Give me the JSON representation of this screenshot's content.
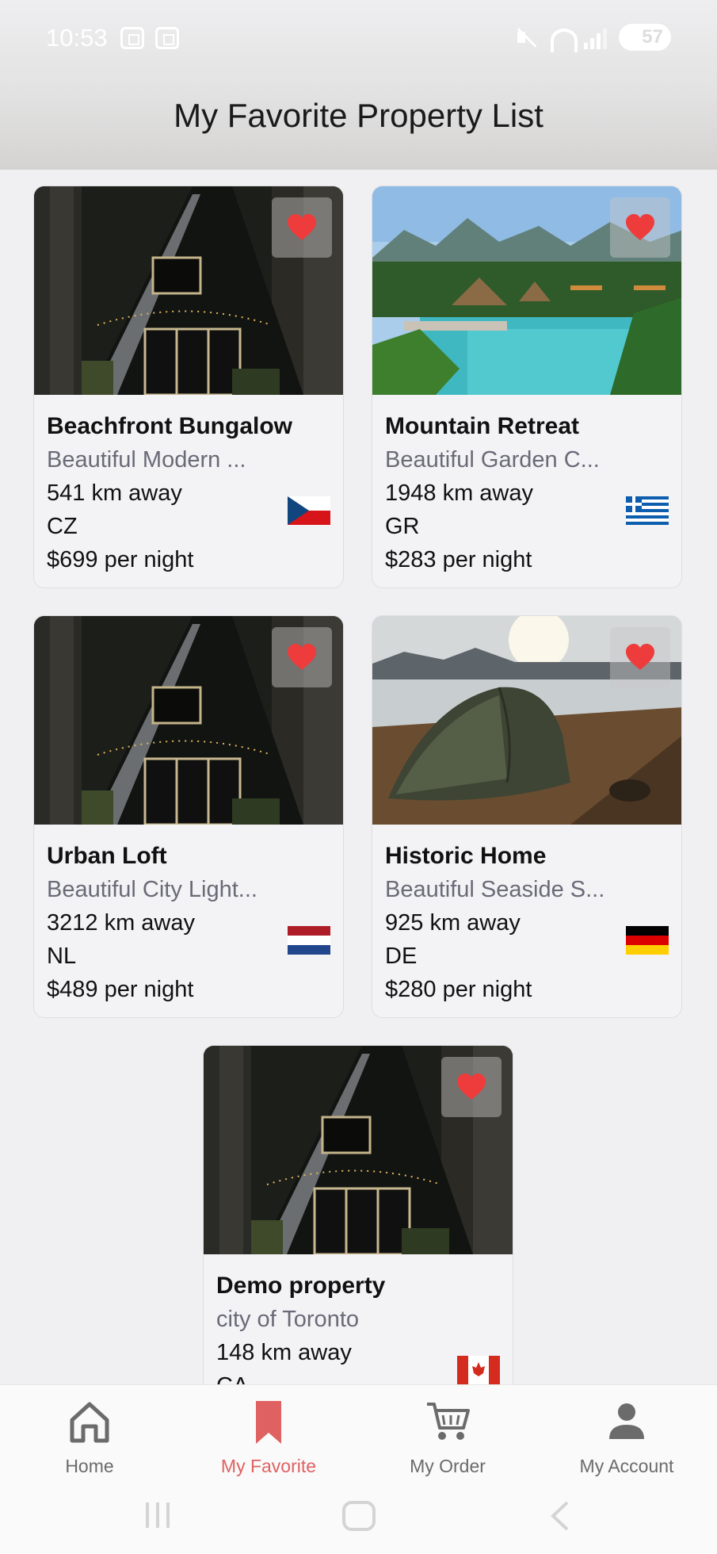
{
  "status_bar": {
    "time": "10:53",
    "battery": "57"
  },
  "header": {
    "title": "My Favorite Property List"
  },
  "properties": [
    {
      "name": "Beachfront Bungalow",
      "description": "Beautiful Modern ...",
      "distance": "541 km away",
      "country": "CZ",
      "price": "$699 per night",
      "image": "a-frame-cabin-forest",
      "favorite": true
    },
    {
      "name": "Mountain Retreat",
      "description": "Beautiful Garden C...",
      "distance": "1948 km away",
      "country": "GR",
      "price": "$283 per night",
      "image": "tropical-resort-pool",
      "favorite": true
    },
    {
      "name": "Urban Loft",
      "description": "Beautiful City Light...",
      "distance": "3212 km away",
      "country": "NL",
      "price": "$489 per night",
      "image": "a-frame-cabin-forest",
      "favorite": true
    },
    {
      "name": "Historic Home",
      "description": "Beautiful Seaside S...",
      "distance": "925 km away",
      "country": "DE",
      "price": "$280 per night",
      "image": "tent-lakeside-sunset",
      "favorite": true
    },
    {
      "name": "Demo property",
      "description": "city of Toronto",
      "distance": "148 km away",
      "country": "CA",
      "price": "",
      "image": "a-frame-cabin-forest",
      "favorite": true
    }
  ],
  "bottom_nav": [
    {
      "label": "Home",
      "icon": "home-icon",
      "active": false
    },
    {
      "label": "My Favorite",
      "icon": "bookmark-icon",
      "active": true
    },
    {
      "label": "My Order",
      "icon": "cart-icon",
      "active": false
    },
    {
      "label": "My Account",
      "icon": "person-icon",
      "active": false
    }
  ],
  "colors": {
    "accent": "#e06161",
    "heart": "#ee3b3b",
    "nav_inactive": "#6b6b6b",
    "subtitle": "#6a6a78"
  }
}
